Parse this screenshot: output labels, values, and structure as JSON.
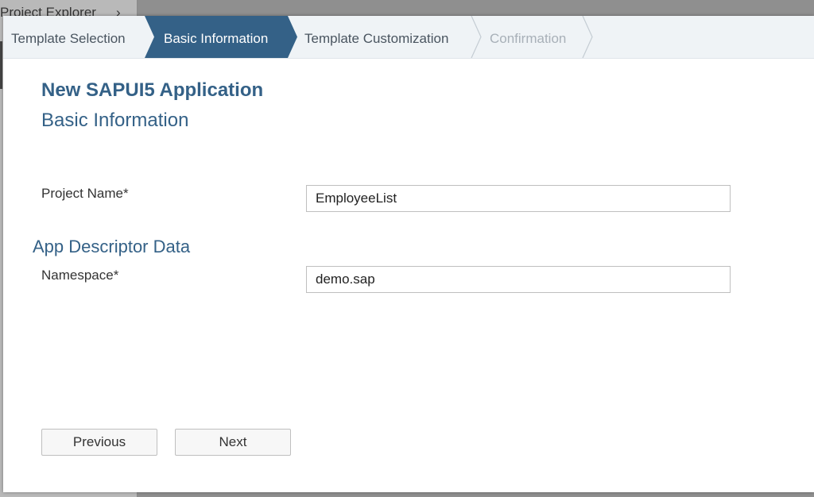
{
  "background": {
    "explorer_title": "Project Explorer",
    "explorer_chevron": "chevron-right-icon"
  },
  "wizard": {
    "steps": [
      {
        "label": "Template Selection",
        "state": "completed"
      },
      {
        "label": "Basic Information",
        "state": "active"
      },
      {
        "label": "Template Customization",
        "state": "pending"
      },
      {
        "label": "Confirmation",
        "state": "disabled"
      }
    ],
    "active_color": "#346187"
  },
  "header": {
    "app_title": "New SAPUI5 Application",
    "page_subtitle": "Basic Information"
  },
  "form": {
    "project_name_label": "Project Name*",
    "project_name_value": "EmployeeList",
    "section_title": "App Descriptor Data",
    "namespace_label": "Namespace*",
    "namespace_value": "demo.sap"
  },
  "footer": {
    "previous_label": "Previous",
    "next_label": "Next"
  }
}
